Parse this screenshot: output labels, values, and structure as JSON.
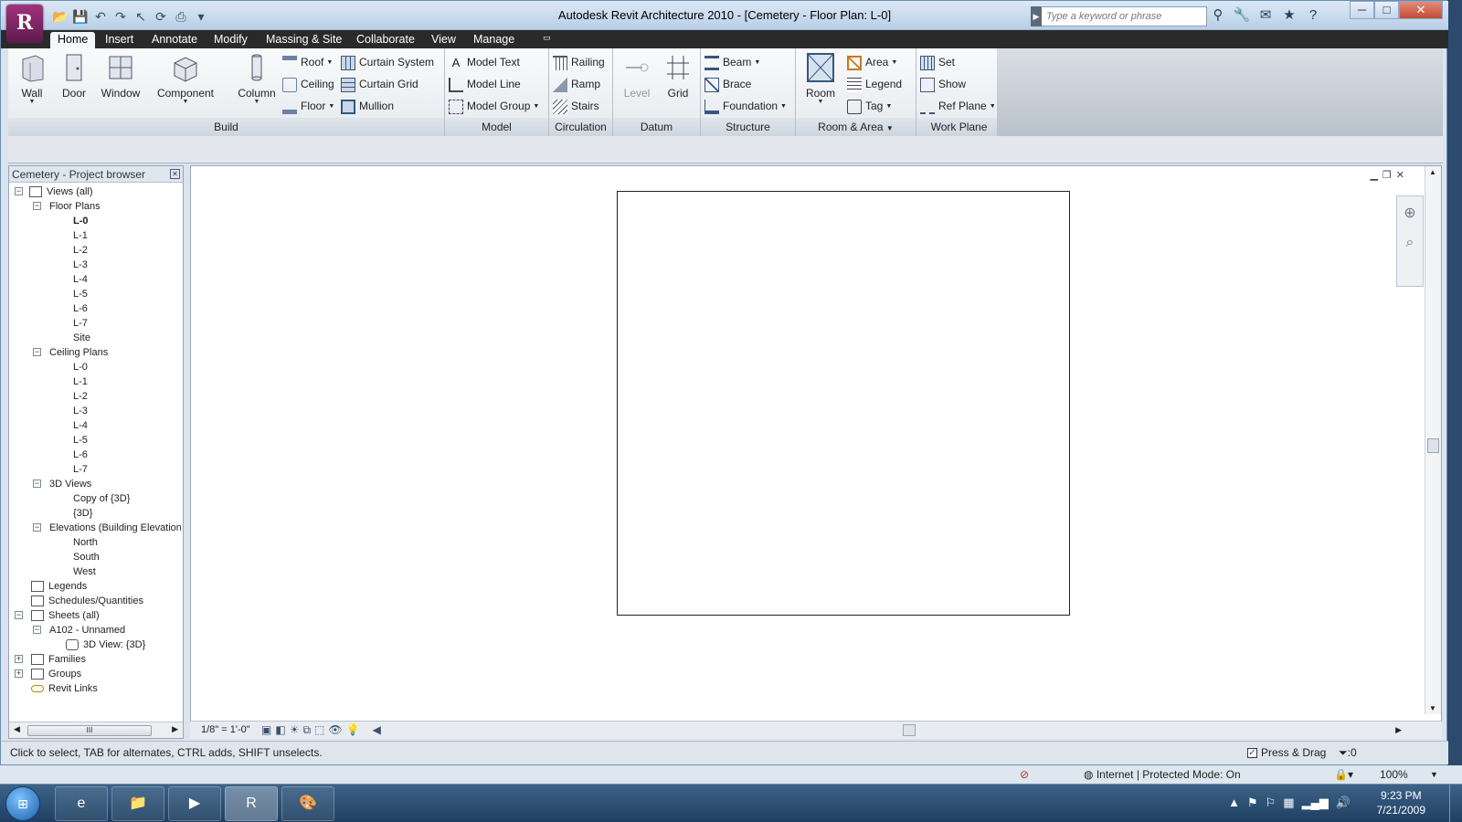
{
  "window": {
    "title": "Autodesk Revit Architecture 2010 - [Cemetery - Floor Plan: L-0]",
    "app_letter": "R",
    "search_placeholder": "Type a keyword or phrase",
    "min": "─",
    "max": "□",
    "close": "✕"
  },
  "tabs": [
    "Home",
    "Insert",
    "Annotate",
    "Modify",
    "Massing & Site",
    "Collaborate",
    "View",
    "Manage"
  ],
  "ribbon": {
    "build": {
      "label": "Build",
      "wall": "Wall",
      "door": "Door",
      "window": "Window",
      "component": "Component",
      "column": "Column",
      "roof": "Roof",
      "ceiling": "Ceiling",
      "floor": "Floor",
      "curtain_system": "Curtain System",
      "curtain_grid": "Curtain Grid",
      "mullion": "Mullion"
    },
    "model": {
      "label": "Model",
      "model_text": "Model Text",
      "model_line": "Model Line",
      "model_group": "Model Group"
    },
    "circulation": {
      "label": "Circulation",
      "railing": "Railing",
      "ramp": "Ramp",
      "stairs": "Stairs"
    },
    "datum": {
      "label": "Datum",
      "level": "Level",
      "grid": "Grid"
    },
    "structure": {
      "label": "Structure",
      "beam": "Beam",
      "brace": "Brace",
      "foundation": "Foundation"
    },
    "room_area": {
      "label": "Room & Area",
      "room": "Room",
      "area": "Area",
      "legend": "Legend",
      "tag": "Tag"
    },
    "work_plane": {
      "label": "Work Plane",
      "set": "Set",
      "show": "Show",
      "ref_plane": "Ref Plane"
    }
  },
  "browser": {
    "title": "Cemetery - Project browser",
    "views_all": "Views (all)",
    "floor_plans": "Floor Plans",
    "floor_items": [
      "L-0",
      "L-1",
      "L-2",
      "L-3",
      "L-4",
      "L-5",
      "L-6",
      "L-7",
      "Site"
    ],
    "ceiling_plans": "Ceiling Plans",
    "ceiling_items": [
      "L-0",
      "L-1",
      "L-2",
      "L-3",
      "L-4",
      "L-5",
      "L-6",
      "L-7"
    ],
    "views_3d": "3D Views",
    "views_3d_items": [
      "Copy of {3D}",
      "{3D}"
    ],
    "elevations": "Elevations (Building Elevation)",
    "elevation_items": [
      "North",
      "South",
      "West"
    ],
    "legends": "Legends",
    "schedules": "Schedules/Quantities",
    "sheets": "Sheets (all)",
    "sheet_a102": "A102 - Unnamed",
    "sheet_view": "3D View: {3D}",
    "families": "Families",
    "groups": "Groups",
    "revit_links": "Revit Links",
    "scroll_grip": "III"
  },
  "viewbar": {
    "scale": "1/8\" = 1'-0\""
  },
  "status": {
    "hint": "Click to select, TAB for alternates, CTRL adds, SHIFT unselects.",
    "press_drag": "Press & Drag",
    "filter_count": ":0"
  },
  "ie": {
    "mode": "Internet | Protected Mode: On",
    "zoom": "100%"
  },
  "taskbar": {
    "time": "9:23 PM",
    "date": "7/21/2009"
  }
}
